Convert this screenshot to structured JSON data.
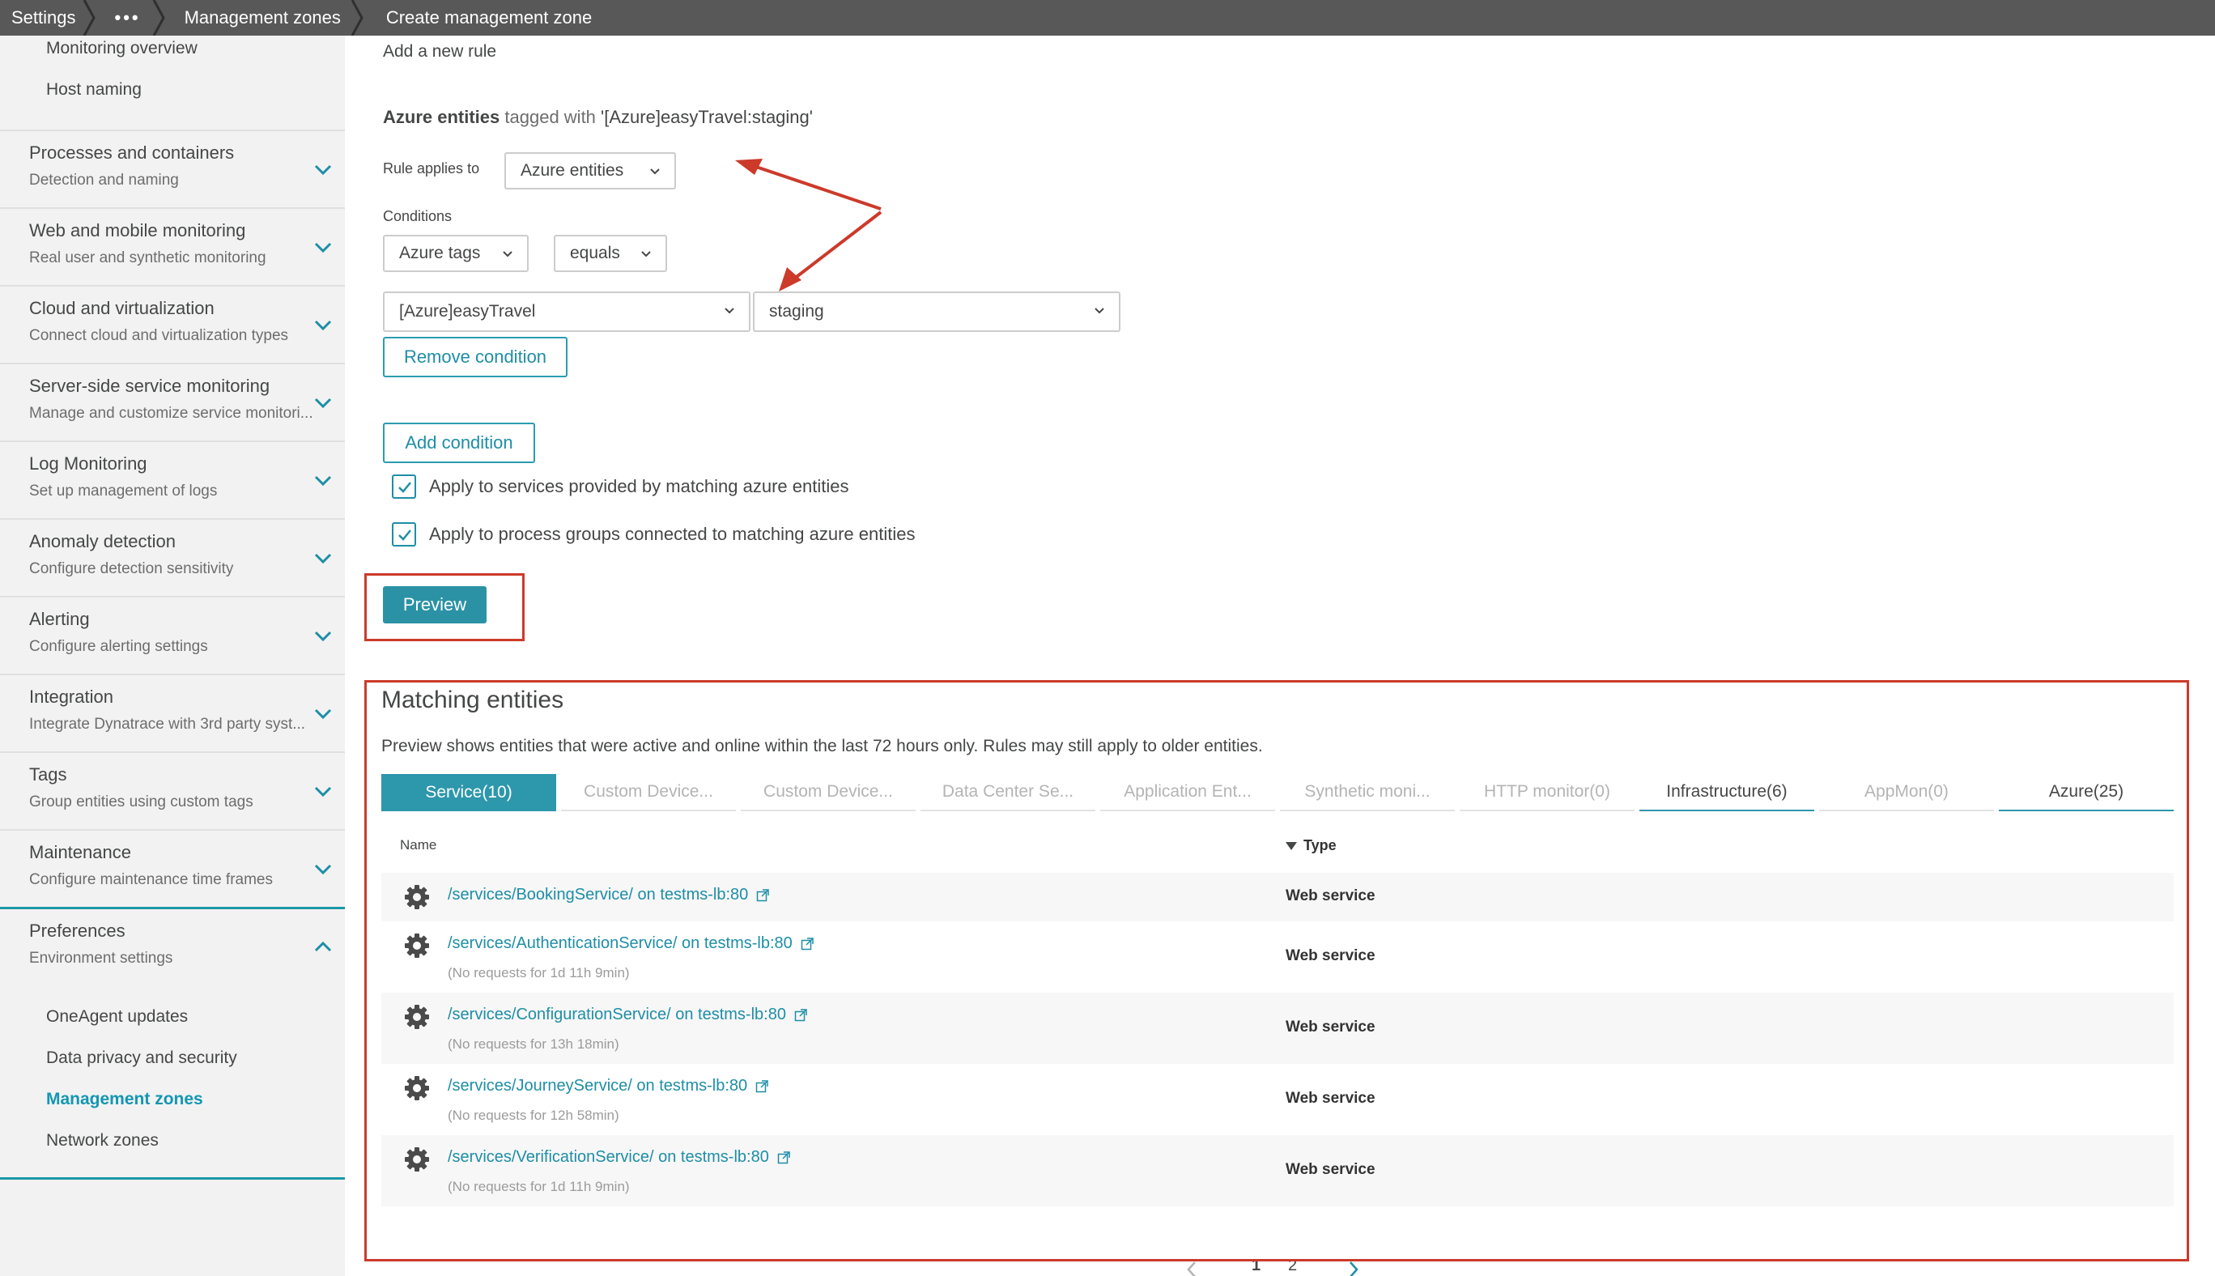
{
  "breadcrumb": {
    "items": [
      "Settings",
      "•••",
      "Management zones",
      "Create management zone"
    ]
  },
  "sidebar": {
    "top_items": [
      "Monitoring overview",
      "Host naming"
    ],
    "groups": [
      {
        "title": "Processes and containers",
        "desc": "Detection and naming"
      },
      {
        "title": "Web and mobile monitoring",
        "desc": "Real user and synthetic monitoring"
      },
      {
        "title": "Cloud and virtualization",
        "desc": "Connect cloud and virtualization types"
      },
      {
        "title": "Server-side service monitoring",
        "desc": "Manage and customize service monitori..."
      },
      {
        "title": "Log Monitoring",
        "desc": "Set up management of logs"
      },
      {
        "title": "Anomaly detection",
        "desc": "Configure detection sensitivity"
      },
      {
        "title": "Alerting",
        "desc": "Configure alerting settings"
      },
      {
        "title": "Integration",
        "desc": "Integrate Dynatrace with 3rd party syst..."
      },
      {
        "title": "Tags",
        "desc": "Group entities using custom tags"
      },
      {
        "title": "Maintenance",
        "desc": "Configure maintenance time frames"
      }
    ],
    "preferences": {
      "title": "Preferences",
      "desc": "Environment settings"
    },
    "pref_items": [
      "OneAgent updates",
      "Data privacy and security",
      "Management zones",
      "Network zones"
    ]
  },
  "rule": {
    "heading": "Add a new rule",
    "desc_bold": "Azure entities",
    "desc_tagged": "tagged with",
    "desc_value": "'[Azure]easyTravel:staging'",
    "applies_label": "Rule applies to",
    "applies_value": "Azure entities",
    "conditions_label": "Conditions",
    "cond_field": "Azure tags",
    "cond_operator": "equals",
    "cond_key": "[Azure]easyTravel",
    "cond_value": "staging",
    "remove_condition": "Remove condition",
    "add_condition": "Add condition",
    "check_services": "Apply to services provided by matching azure entities",
    "check_process_groups": "Apply to process groups connected to matching azure entities",
    "preview": "Preview"
  },
  "matching": {
    "title": "Matching entities",
    "note": "Preview shows entities that were active and online within the last 72 hours only. Rules may still apply to older entities.",
    "tabs": [
      {
        "label": "Service(10)",
        "state": "active"
      },
      {
        "label": "Custom Device...",
        "state": "disabled"
      },
      {
        "label": "Custom Device...",
        "state": "disabled"
      },
      {
        "label": "Data Center Se...",
        "state": "disabled"
      },
      {
        "label": "Application Ent...",
        "state": "disabled"
      },
      {
        "label": "Synthetic moni...",
        "state": "disabled"
      },
      {
        "label": "HTTP monitor(0)",
        "state": "disabled"
      },
      {
        "label": "Infrastructure(6)",
        "state": "enabled"
      },
      {
        "label": "AppMon(0)",
        "state": "disabled"
      },
      {
        "label": "Azure(25)",
        "state": "enabled"
      }
    ],
    "col_name": "Name",
    "col_type": "Type",
    "rows": [
      {
        "name": "/services/BookingService/ on testms-lb:80",
        "sub": "",
        "type": "Web service"
      },
      {
        "name": "/services/AuthenticationService/ on testms-lb:80",
        "sub": "(No requests for 1d 11h 9min)",
        "type": "Web service"
      },
      {
        "name": "/services/ConfigurationService/ on testms-lb:80",
        "sub": "(No requests for 13h 18min)",
        "type": "Web service"
      },
      {
        "name": "/services/JourneyService/ on testms-lb:80",
        "sub": "(No requests for 12h 58min)",
        "type": "Web service"
      },
      {
        "name": "/services/VerificationService/ on testms-lb:80",
        "sub": "(No requests for 1d 11h 9min)",
        "type": "Web service"
      }
    ],
    "pages": [
      "1",
      "2"
    ],
    "current_page": "1"
  },
  "colors": {
    "accent": "#2b92a5",
    "annotation": "#cc3a2a",
    "topbar": "#585858"
  }
}
